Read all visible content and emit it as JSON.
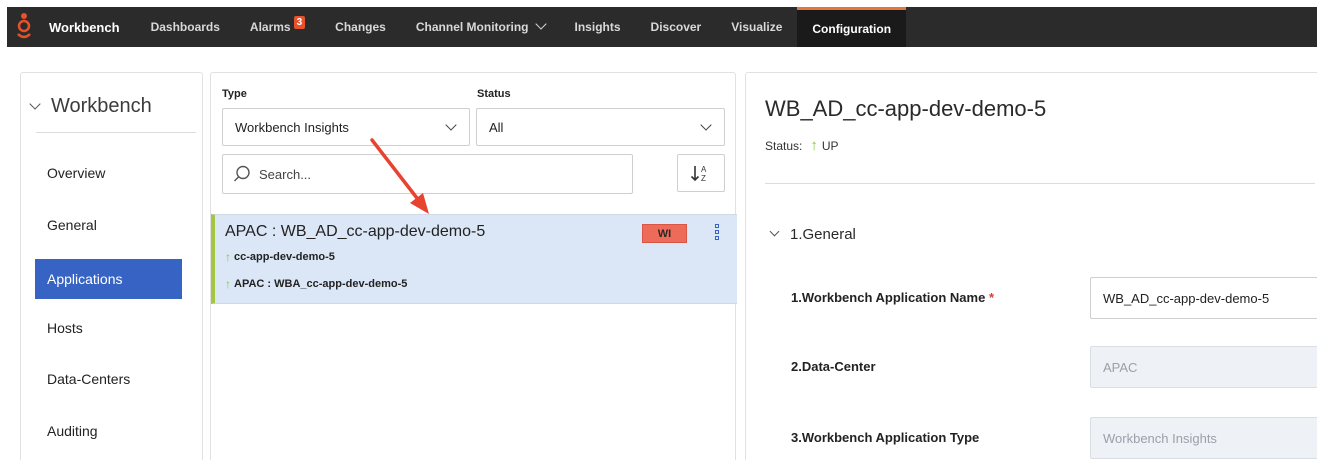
{
  "topbar": {
    "brand": "Workbench",
    "nav": [
      {
        "label": "Dashboards"
      },
      {
        "label": "Alarms",
        "badge": "3"
      },
      {
        "label": "Changes"
      },
      {
        "label": "Channel Monitoring"
      },
      {
        "label": "Insights"
      },
      {
        "label": "Discover"
      },
      {
        "label": "Visualize"
      },
      {
        "label": "Configuration"
      }
    ],
    "accent": "#e8743b"
  },
  "left": {
    "title": "Workbench",
    "items": [
      {
        "label": "Overview"
      },
      {
        "label": "General"
      },
      {
        "label": "Applications"
      },
      {
        "label": "Hosts"
      },
      {
        "label": "Data-Centers"
      },
      {
        "label": "Auditing"
      }
    ],
    "active_color": "#3663c4"
  },
  "middle": {
    "type_label": "Type",
    "type_value": "Workbench Insights",
    "status_label": "Status",
    "status_value": "All",
    "search_placeholder": "Search...",
    "sort_icon": "sort-alpha-icon",
    "list": [
      {
        "title": "APAC : WB_AD_cc-app-dev-demo-5",
        "line1": "cc-app-dev-demo-5",
        "line2": "APAC : WBA_cc-app-dev-demo-5",
        "tag": "WI"
      }
    ]
  },
  "right": {
    "title": "WB_AD_cc-app-dev-demo-5",
    "status_label": "Status:",
    "status_value": "UP",
    "section": "1.General",
    "fields": [
      {
        "label": "1.Workbench Application Name",
        "required": "*",
        "value": "WB_AD_cc-app-dev-demo-5"
      },
      {
        "label": "2.Data-Center",
        "value": "APAC"
      },
      {
        "label": "3.Workbench Application Type",
        "value": "Workbench Insights"
      }
    ]
  },
  "up_icon": "arrow-up-icon"
}
